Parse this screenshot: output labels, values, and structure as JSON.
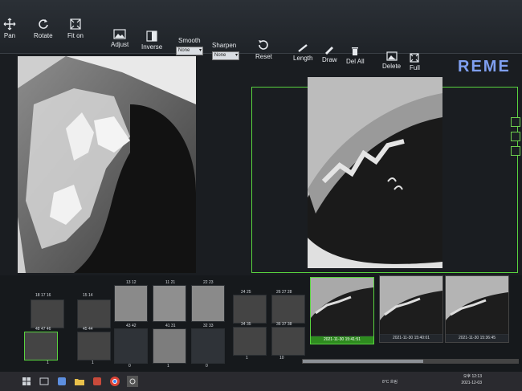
{
  "toolbar": {
    "pan": "Pan",
    "rotate": "Rotate",
    "fit_on": "Fit on",
    "adjust": "Adjust",
    "inverse": "Inverse",
    "smooth": "Smooth",
    "smooth_value": "None",
    "sharpen": "Sharpen",
    "sharpen_value": "None",
    "reset": "Reset",
    "length": "Length",
    "draw": "Draw",
    "del_all": "Del All",
    "delete": "Delete",
    "full": "Full"
  },
  "brand": "REME",
  "thumbnails": {
    "top_row": [
      {
        "label": "18 17 16"
      },
      {
        "label": "15 14"
      },
      {
        "label": "13 12"
      },
      {
        "label": "11 21"
      },
      {
        "label": "22 23"
      },
      {
        "label": "24 25"
      },
      {
        "label": "26 27 28"
      }
    ],
    "bottom_row": [
      {
        "label": "48 47 46",
        "count": "1"
      },
      {
        "label": "45 44",
        "count": "1"
      },
      {
        "label": "43 42",
        "count": "0"
      },
      {
        "label": "41 31",
        "count": "1"
      },
      {
        "label": "32 33",
        "count": "0"
      },
      {
        "label": "34 35",
        "count": "1"
      },
      {
        "label": "36 37 38",
        "count": "10"
      }
    ]
  },
  "studies": [
    {
      "caption": "2021-11-30 15:41:51"
    },
    {
      "caption": "2021-11-30 15:40:01"
    },
    {
      "caption": "2021-11-30 15:36:45"
    }
  ],
  "taskbar": {
    "weather": "8°C 흐림",
    "time": "오후 12:13",
    "date": "2021-12-03"
  },
  "colors": {
    "accent_green": "#59d43f",
    "brand_blue": "#7f9ff0",
    "toolbar_bg": "#2b3036"
  }
}
